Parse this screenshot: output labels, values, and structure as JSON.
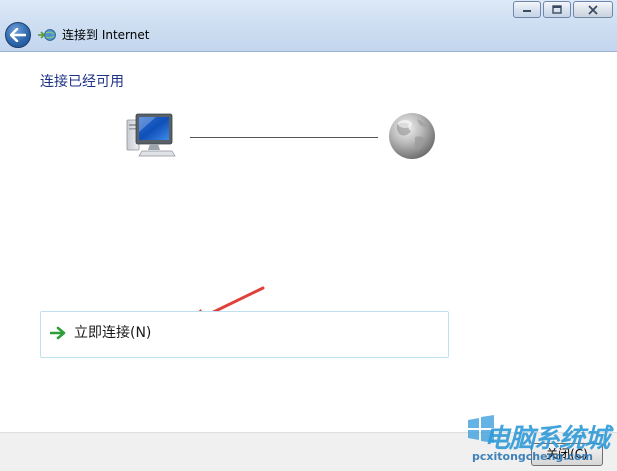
{
  "window": {
    "title": "连接到 Internet"
  },
  "main": {
    "heading": "连接已经可用",
    "connect_button_label": "立即连接(N)"
  },
  "footer": {
    "close_button_label": "关闭(C)"
  },
  "watermark": {
    "brand": "电脑系统城",
    "url": "pcxitongcheng.com"
  },
  "colors": {
    "heading": "#1e3287",
    "connect_border": "#bfe1ef",
    "annotation_arrow": "#e0403a",
    "watermark": "#2f9ad8"
  },
  "icons": {
    "back": "back-arrow-icon",
    "title": "network-globe-icon",
    "computer": "computer-icon",
    "internet": "globe-icon",
    "connect": "green-arrow-icon"
  }
}
